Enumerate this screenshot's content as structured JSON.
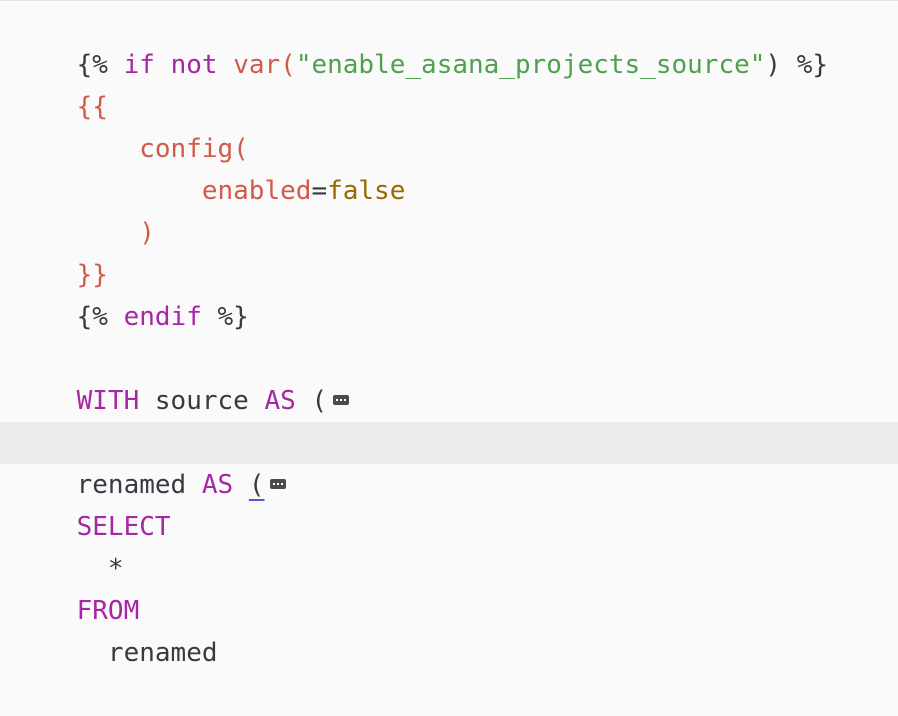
{
  "lines": {
    "l1": {
      "a": "{% ",
      "b": "if",
      "c": " ",
      "d": "not",
      "e": " ",
      "f": "var(",
      "g": "\"enable_asana_projects_source\"",
      "h": ") %}"
    },
    "l2": {
      "a": "{{"
    },
    "l3": {
      "a": "    config("
    },
    "l4": {
      "a": "        enabled",
      "b": "=",
      "c": "false"
    },
    "l5": {
      "a": "    )"
    },
    "l6": {
      "a": "}}"
    },
    "l7": {
      "a": "{% ",
      "b": "endif",
      "c": " %}"
    },
    "l9": {
      "a": "WITH",
      "b": " source ",
      "c": "AS",
      "d": " ("
    },
    "l11": {
      "a": "renamed ",
      "b": "AS",
      "c": " ",
      "d": "("
    },
    "l12": {
      "a": "SELECT"
    },
    "l13": {
      "a": "  *"
    },
    "l14": {
      "a": "FROM"
    },
    "l15": {
      "a": "  renamed"
    }
  },
  "icons": {
    "fold": "fold-ellipsis-icon"
  }
}
